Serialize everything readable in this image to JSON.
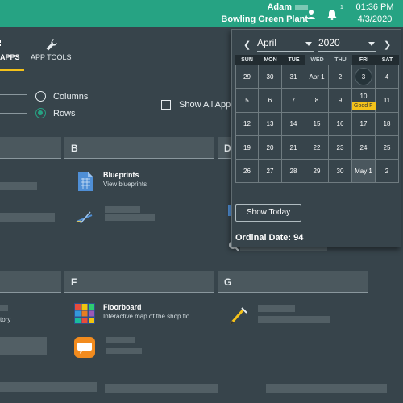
{
  "topbar": {
    "user_name": "Adam",
    "plant": "Bowling Green Plant",
    "time": "01:36 PM",
    "date": "4/3/2020",
    "notif_count": "1",
    "icons": [
      "person-icon",
      "bell-icon"
    ]
  },
  "nav": {
    "apps_label": "APPS",
    "tools_label": "APP TOOLS"
  },
  "view_options": {
    "columns_label": "Columns",
    "rows_label": "Rows",
    "selected": "Rows",
    "show_all_label": "Show All Apps"
  },
  "sections": {
    "b": "B",
    "d": "D",
    "f": "F",
    "g": "G"
  },
  "apps": {
    "blueprints": {
      "title": "Blueprints",
      "desc": "View blueprints"
    },
    "floorboard": {
      "title": "Floorboard",
      "desc": "Interactive map of the shop flo..."
    },
    "partial_left": "tory"
  },
  "calendar": {
    "month": "April",
    "year": "2020",
    "days_of_week": [
      "SUN",
      "MON",
      "TUE",
      "WED",
      "THU",
      "FRI",
      "SAT"
    ],
    "weeks": [
      [
        "29",
        "30",
        "31",
        "Apr 1",
        "2",
        "3",
        "4"
      ],
      [
        "5",
        "6",
        "7",
        "8",
        "9",
        "10",
        "11"
      ],
      [
        "12",
        "13",
        "14",
        "15",
        "16",
        "17",
        "18"
      ],
      [
        "19",
        "20",
        "21",
        "22",
        "23",
        "24",
        "25"
      ],
      [
        "26",
        "27",
        "28",
        "29",
        "30",
        "May 1",
        "2"
      ]
    ],
    "today": "3",
    "event_label": "Good F",
    "show_today_label": "Show Today",
    "ordinal_label": "Ordinal Date: 94"
  },
  "colors": {
    "accent": "#26a383",
    "background": "#37444b",
    "highlight": "#f4c21a"
  }
}
